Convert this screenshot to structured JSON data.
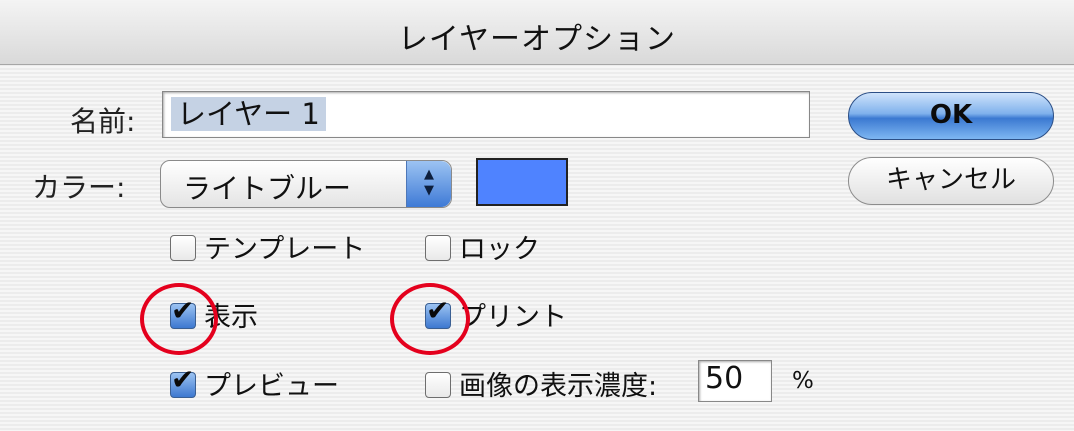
{
  "window": {
    "title": "レイヤーオプション"
  },
  "name_field": {
    "label": "名前:",
    "value": "レイヤー 1"
  },
  "color_field": {
    "label": "カラー:",
    "selected": "ライトブルー",
    "swatch_color": "#4f83ff"
  },
  "checkboxes": {
    "template": {
      "label": "テンプレート",
      "checked": false
    },
    "lock": {
      "label": "ロック",
      "checked": false
    },
    "show": {
      "label": "表示",
      "checked": true
    },
    "print": {
      "label": "プリント",
      "checked": true
    },
    "preview": {
      "label": "プレビュー",
      "checked": true
    },
    "dim_images": {
      "label": "画像の表示濃度:",
      "checked": false
    }
  },
  "dim_value": {
    "value": "50",
    "unit": "%"
  },
  "buttons": {
    "ok": "OK",
    "cancel": "キャンセル"
  },
  "annotation_color": "#e4001d"
}
